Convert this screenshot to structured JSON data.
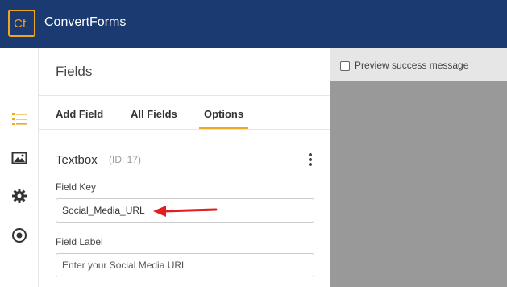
{
  "app": {
    "logo_text": "Cf",
    "brand": "ConvertForms",
    "colors": {
      "header": "#1c3a72",
      "accent": "#f0a61f",
      "preview_bg": "#999999"
    }
  },
  "sidebar_icons": [
    "list-icon",
    "image-icon",
    "gear-icon",
    "target-icon"
  ],
  "panel": {
    "title": "Fields",
    "tabs": [
      "Add Field",
      "All Fields",
      "Options"
    ],
    "active_tab": "Options",
    "field": {
      "type": "Textbox",
      "id_label": "(ID: 17)",
      "key_label": "Field Key",
      "key_value": "Social_Media_URL",
      "label_label": "Field Label",
      "label_placeholder": "Enter your Social Media URL"
    }
  },
  "preview": {
    "checkbox_label": "Preview success message",
    "checked": false
  }
}
